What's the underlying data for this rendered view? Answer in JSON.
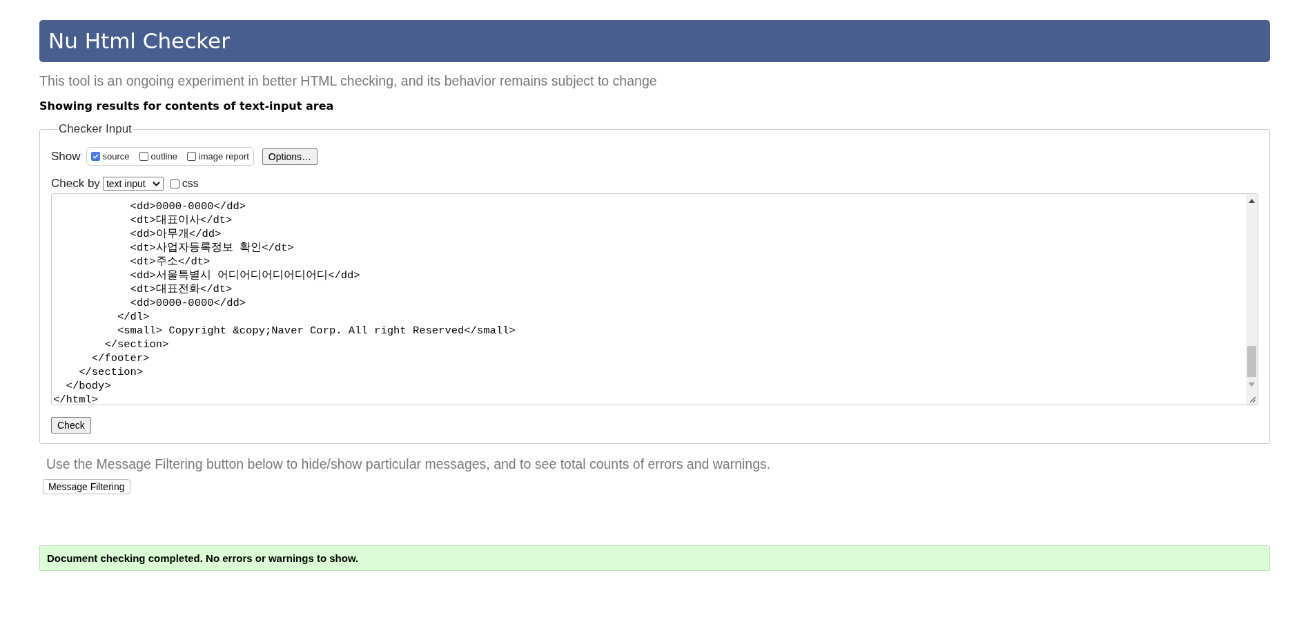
{
  "header": {
    "title": "Nu Html Checker"
  },
  "intro": "This tool is an ongoing experiment in better HTML checking, and its behavior remains subject to change",
  "results_heading": "Showing results for contents of text-input area",
  "checker_input": {
    "legend": "Checker Input",
    "show_label": "Show",
    "show_options": [
      {
        "label": "source",
        "checked": true
      },
      {
        "label": "outline",
        "checked": false
      },
      {
        "label": "image report",
        "checked": false
      }
    ],
    "options_button": "Options…",
    "check_by_label": "Check by",
    "check_by_select": "text input",
    "css_option": {
      "label": "css",
      "checked": false
    },
    "source_lines": [
      "            <dd>0000-0000</dd>",
      "            <dt>대표이사</dt>",
      "            <dd>아무개</dd>",
      "            <dt>사업자등록정보 확인</dt>",
      "            <dt>주소</dt>",
      "            <dd>서울특별시 어디어디어디어디어디</dd>",
      "            <dt>대표전화</dt>",
      "            <dd>0000-0000</dd>",
      "          </dl>",
      "          <small> Copyright &copy;Naver Corp. All right Reserved</small>",
      "        </section>",
      "      </footer>",
      "    </section>",
      "  </body>",
      "</html>"
    ],
    "check_button": "Check"
  },
  "filter_hint": "Use the Message Filtering button below to hide/show particular messages, and to see total counts of errors and warnings.",
  "filter_button": "Message Filtering",
  "status": "Document checking completed. No errors or warnings to show."
}
